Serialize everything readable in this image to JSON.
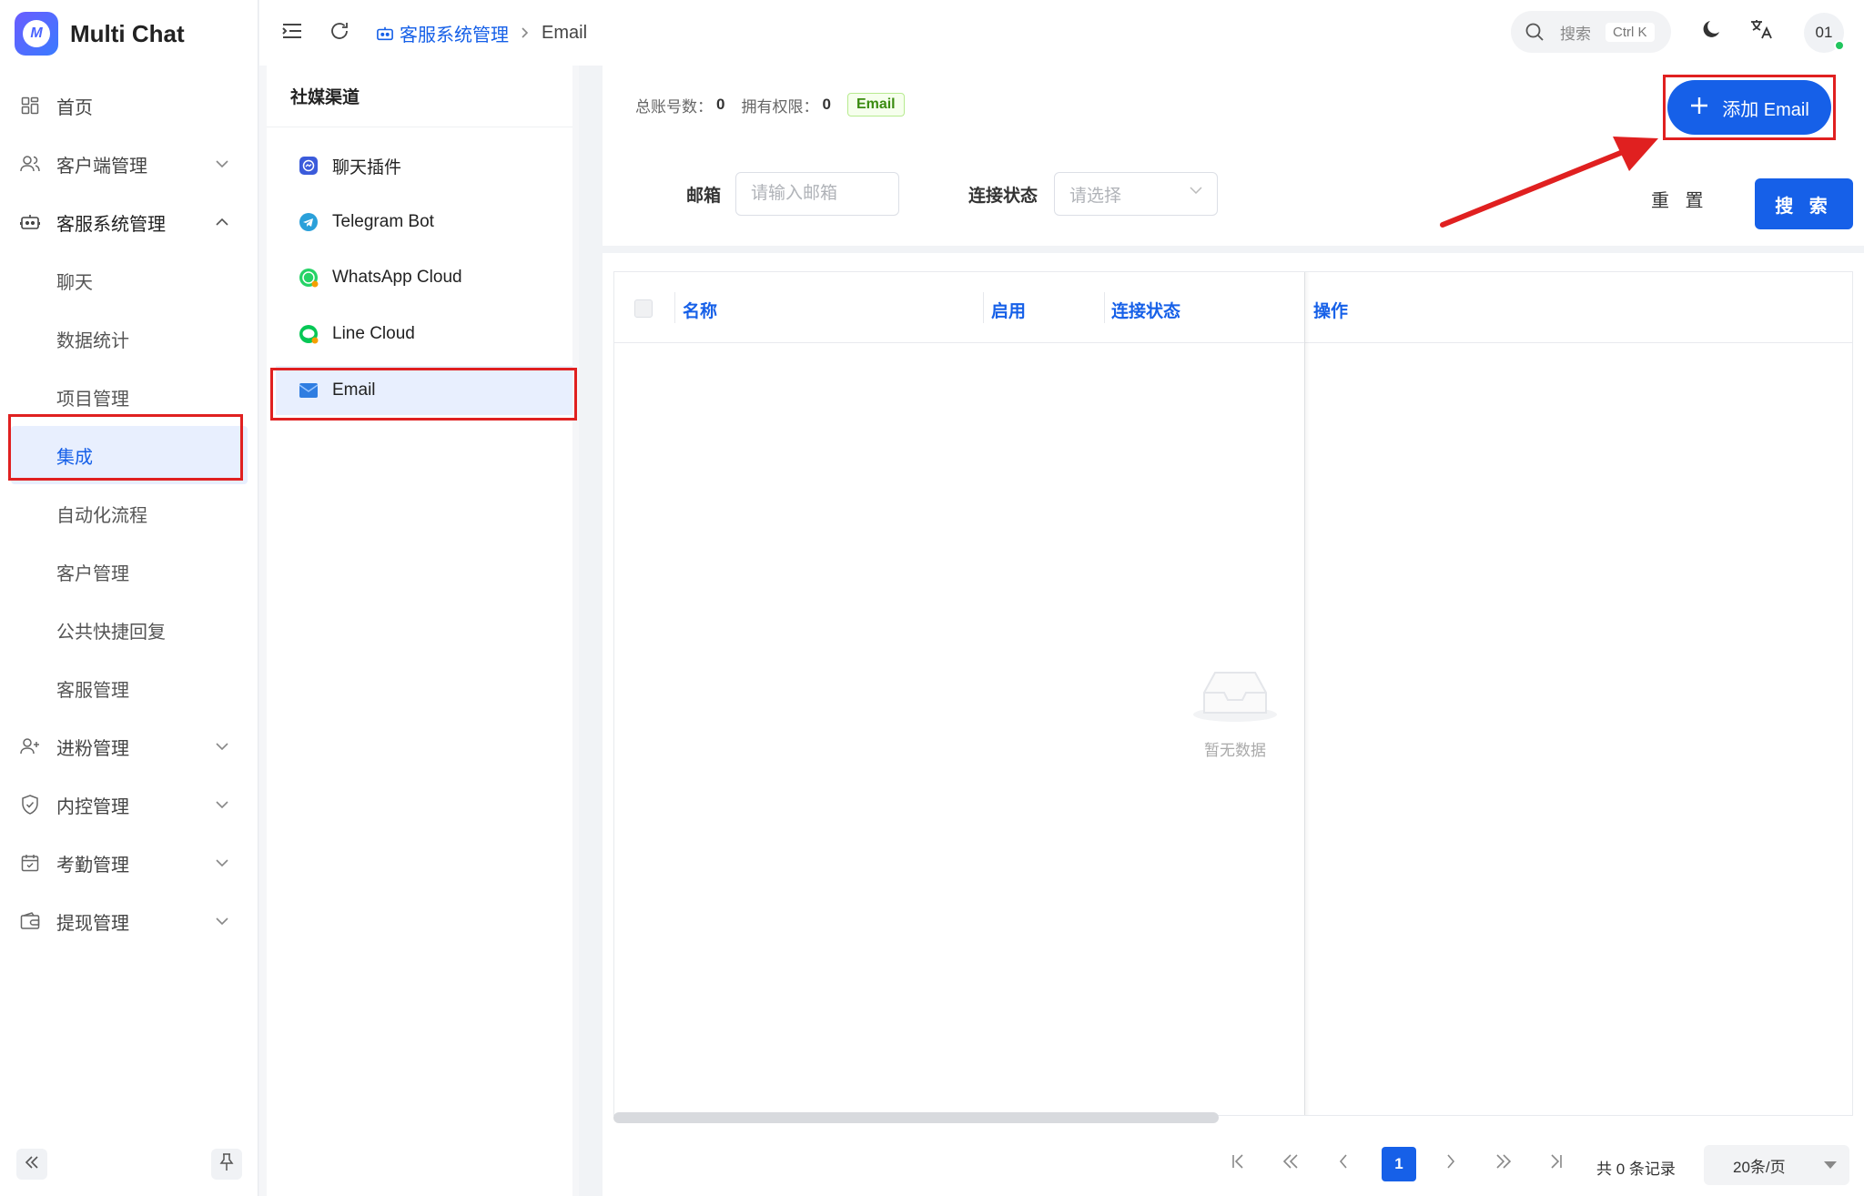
{
  "app": {
    "name": "Multi Chat",
    "logo_letter": "M"
  },
  "sidebar": {
    "items": [
      {
        "label": "首页",
        "icon": "dashboard-icon"
      },
      {
        "label": "客户端管理",
        "icon": "users-icon",
        "expandable": true
      },
      {
        "label": "客服系统管理",
        "icon": "robot-icon",
        "expandable": true,
        "expanded": true
      }
    ],
    "sub_items": [
      "聊天",
      "数据统计",
      "项目管理",
      "集成",
      "自动化流程",
      "客户管理",
      "公共快捷回复",
      "客服管理"
    ],
    "active_sub": "集成",
    "more_items": [
      {
        "label": "进粉管理",
        "icon": "user-plus-icon"
      },
      {
        "label": "内控管理",
        "icon": "shield-icon"
      },
      {
        "label": "考勤管理",
        "icon": "calendar-check-icon"
      },
      {
        "label": "提现管理",
        "icon": "wallet-icon"
      }
    ]
  },
  "topbar": {
    "breadcrumb_parent": "客服系统管理",
    "breadcrumb_current": "Email",
    "search_label": "搜索",
    "search_shortcut": "Ctrl K",
    "avatar_text": "01"
  },
  "channels": {
    "title": "社媒渠道",
    "items": [
      {
        "label": "聊天插件",
        "icon": "chat-plugin-icon",
        "color": "#3b5bdb"
      },
      {
        "label": "Telegram Bot",
        "icon": "telegram-icon",
        "color": "#2aa0da"
      },
      {
        "label": "WhatsApp Cloud",
        "icon": "whatsapp-icon",
        "color": "#25d366"
      },
      {
        "label": "Line Cloud",
        "icon": "line-icon",
        "color": "#06c755"
      },
      {
        "label": "Email",
        "icon": "email-icon",
        "color": "#2f7de1"
      }
    ],
    "active": "Email"
  },
  "main": {
    "stats": {
      "total_label": "总账号数：",
      "total_value": "0",
      "quota_label": "拥有权限：",
      "quota_value": "0",
      "tag": "Email"
    },
    "add_button": "添加 Email",
    "filters": {
      "email_label": "邮箱",
      "email_placeholder": "请输入邮箱",
      "status_label": "连接状态",
      "status_placeholder": "请选择",
      "reset": "重 置",
      "search": "搜 索"
    },
    "table": {
      "columns": [
        "名称",
        "启用",
        "连接状态",
        "操作"
      ],
      "empty_text": "暂无数据"
    },
    "pagination": {
      "current_page": "1",
      "total_text": "共 0 条记录",
      "page_size": "20条/页"
    }
  },
  "colors": {
    "primary": "#1660e8",
    "highlight": "#e02020",
    "tag_green": "#3a8b10"
  }
}
